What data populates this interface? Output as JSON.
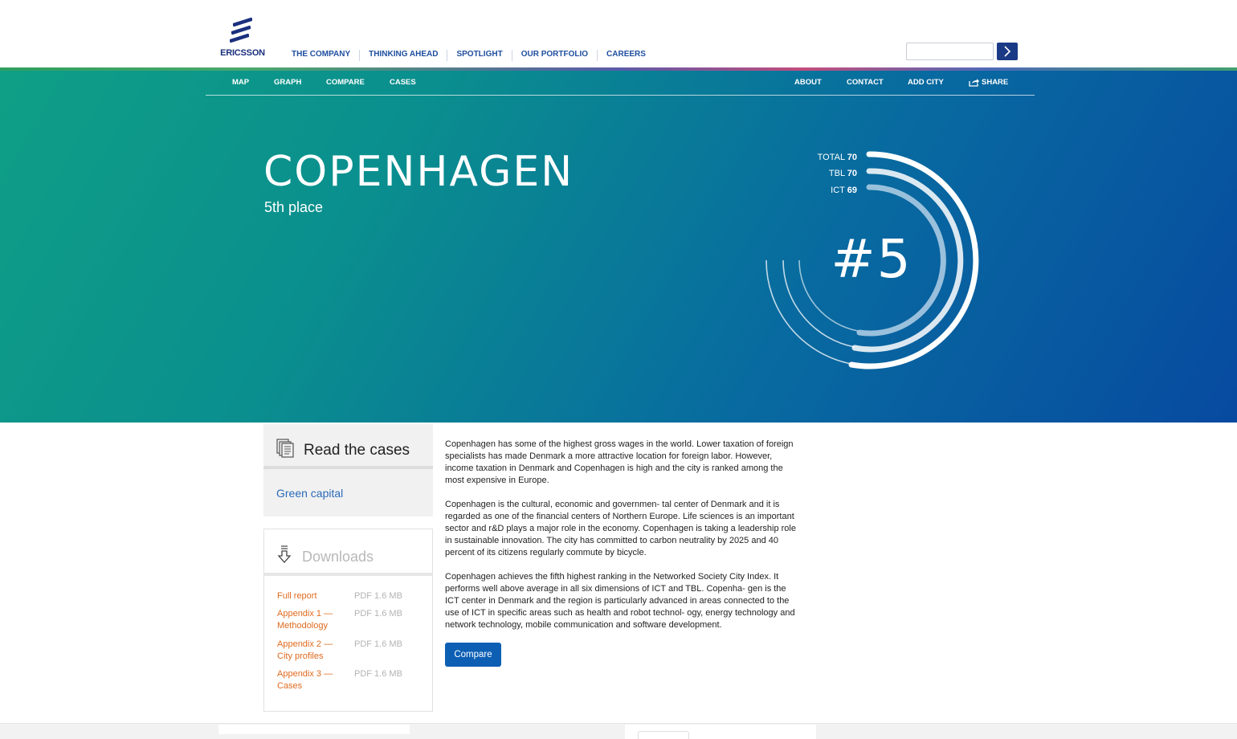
{
  "brand": {
    "name": "ERICSSON",
    "color": "#1a2f7e"
  },
  "main_nav": [
    "THE COMPANY",
    "THINKING AHEAD",
    "SPOTLIGHT",
    "OUR PORTFOLIO",
    "CAREERS"
  ],
  "search": {
    "placeholder": "",
    "button_icon": "chevron-right-icon"
  },
  "sub_nav": {
    "left": [
      "MAP",
      "GRAPH",
      "COMPARE",
      "CASES"
    ],
    "right": [
      "ABOUT",
      "CONTACT",
      "ADD CITY",
      "SHARE"
    ],
    "share_icon": "share-icon"
  },
  "city": {
    "name": "COPENHAGEN",
    "place": "5th place",
    "rank": "#5"
  },
  "scores": [
    {
      "label": "TOTAL",
      "value": "70"
    },
    {
      "label": "TBL",
      "value": "70"
    },
    {
      "label": "ICT",
      "value": "69"
    }
  ],
  "cases": {
    "title": "Read the cases",
    "icon": "documents-icon",
    "items": [
      "Green capital"
    ]
  },
  "downloads": {
    "title": "Downloads",
    "icon": "download-icon",
    "items": [
      {
        "name": "Full report",
        "size": "PDF 1.6 MB"
      },
      {
        "name": "Appendix 1 — Methodology",
        "size": "PDF 1.6 MB"
      },
      {
        "name": "Appendix 2 — City profiles",
        "size": "PDF 1.6 MB"
      },
      {
        "name": "Appendix 3 — Cases",
        "size": "PDF 1.6 MB"
      }
    ]
  },
  "body": {
    "paragraphs": [
      "Copenhagen has some of the highest gross wages in the world. Lower taxation of foreign specialists has made Denmark a more attractive location for foreign labor. However, income taxation in Denmark and Copenhagen is high and the city is ranked among the most expensive in Europe.",
      "Copenhagen is the cultural, economic and governmen- tal center of Denmark and it is regarded as one of the financial centers of Northern Europe. Life sciences is an important sector and r&D plays a major role in the economy. Copenhagen is taking a leadership role in sustainable innovation. The city has committed to carbon neutrality by 2025 and 40 percent of its citizens regularly commute by bicycle.",
      "Copenhagen achieves the fifth highest ranking in the Networked Society City Index. It performs well above average in all six dimensions of ICT and TBL. Copenha- gen is the ICT center in Denmark and the region is particularly advanced in areas connected to the use of ICT in specific areas such as health and robot technol- ogy, energy technology and network technology, mobile communication and software development."
    ],
    "compare_label": "Compare"
  },
  "colors": {
    "hero_start": "#0f9f86",
    "hero_end": "#074aa0",
    "link_blue": "#2a6ab8",
    "download_orange": "#e06a1e",
    "button_blue": "#0d5fb4"
  }
}
